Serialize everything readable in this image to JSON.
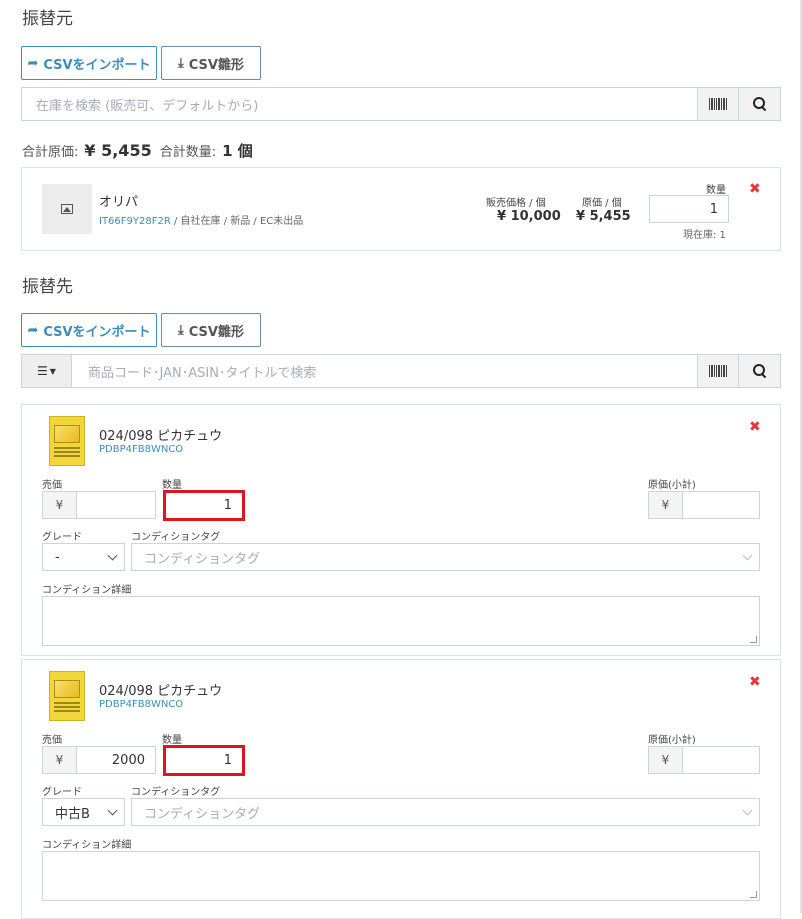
{
  "source": {
    "title": "振替元",
    "import_btn": "CSVをインポート",
    "template_btn": "CSV雛形",
    "search_placeholder": "在庫を検索 (販売可、デフォルトから)",
    "totals": {
      "cost_label": "合計原価:",
      "cost_value": "¥ 5,455",
      "qty_label": "合計数量:",
      "qty_value": "1 個"
    },
    "item": {
      "name": "オリパ",
      "sku": "IT66F9Y28F2R",
      "meta": " / 自社在庫 / 新品 / EC未出品",
      "price_label": "販売価格 / 個",
      "price_value": "¥ 10,000",
      "cost_label": "原価 / 個",
      "cost_value": "¥ 5,455",
      "qty_label": "数量",
      "qty_value": "1",
      "stock_label": "現在庫: 1",
      "remove": "✖"
    }
  },
  "dest": {
    "title": "振替先",
    "import_btn": "CSVをインポート",
    "template_btn": "CSV雛形",
    "search_placeholder": "商品コード･JAN･ASIN･タイトルで検索",
    "items": [
      {
        "name": "024/098 ピカチュウ",
        "sku": "PDBP4FB8WNCO",
        "price_label": "売価",
        "yen": "¥",
        "price_value": "",
        "qty_label": "数量",
        "qty_value": "1",
        "cost_label": "原価(小計)",
        "cost_value": "",
        "grade_label": "グレード",
        "grade_value": "-",
        "cond_tag_label": "コンディションタグ",
        "cond_tag_placeholder": "コンディションタグ",
        "cond_detail_label": "コンディション詳細",
        "remove": "✖"
      },
      {
        "name": "024/098 ピカチュウ",
        "sku": "PDBP4FB8WNCO",
        "price_label": "売価",
        "yen": "¥",
        "price_value": "2000",
        "qty_label": "数量",
        "qty_value": "1",
        "cost_label": "原価(小計)",
        "cost_value": "",
        "grade_label": "グレード",
        "grade_value": "中古B",
        "cond_tag_label": "コンディションタグ",
        "cond_tag_placeholder": "コンディションタグ",
        "cond_detail_label": "コンディション詳細",
        "remove": "✖"
      }
    ]
  },
  "colors": {
    "accent": "#3c8dbc",
    "highlight": "#e0141e",
    "remove": "#dd3b3b"
  }
}
